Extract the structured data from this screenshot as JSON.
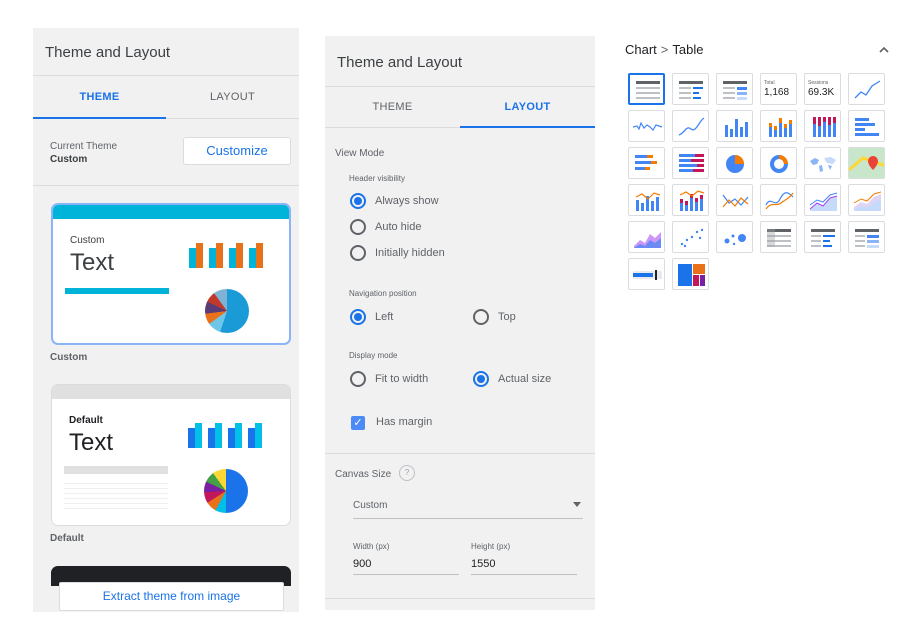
{
  "theme_panel": {
    "title": "Theme and Layout",
    "tabs": [
      "THEME",
      "LAYOUT"
    ],
    "current_theme_label": "Current Theme",
    "current_theme_value": "Custom",
    "customize_label": "Customize",
    "cards": [
      {
        "name": "Custom",
        "text": "Text",
        "caption": "Custom"
      },
      {
        "name": "Default",
        "text": "Text",
        "caption": "Default"
      }
    ],
    "extract_label": "Extract theme from image"
  },
  "layout_panel": {
    "title": "Theme and Layout",
    "tabs": [
      "THEME",
      "LAYOUT"
    ],
    "view_mode_label": "View Mode",
    "header_visibility_label": "Header visibility",
    "header_options": [
      "Always show",
      "Auto hide",
      "Initially hidden"
    ],
    "header_selected": "Always show",
    "nav_position_label": "Navigation position",
    "nav_options": [
      "Left",
      "Top"
    ],
    "nav_selected": "Left",
    "display_mode_label": "Display mode",
    "display_options": [
      "Fit to width",
      "Actual size"
    ],
    "display_selected": "Actual size",
    "has_margin_label": "Has margin",
    "has_margin_checked": true,
    "canvas_size_label": "Canvas Size",
    "help_icon_text": "?",
    "canvas_size_value": "Custom",
    "width_label": "Width (px)",
    "width_value": "900",
    "height_label": "Height (px)",
    "height_value": "1550"
  },
  "chart_picker": {
    "breadcrumb_parent": "Chart",
    "breadcrumb_sep": ">",
    "breadcrumb_current": "Table",
    "kpi_total_label": "Total",
    "kpi_total_value": "1,168",
    "kpi_sessions_label": "Sessions",
    "kpi_sessions_value": "69.3K",
    "items": [
      "table",
      "table-bars",
      "table-heatmap",
      "scorecard",
      "scorecard-compact",
      "time-series",
      "sparkline",
      "smoothed-time-series",
      "column",
      "stacked-column",
      "100-stacked-column",
      "bar",
      "stacked-bar",
      "100-stacked-bar",
      "pie",
      "donut",
      "geo-map",
      "google-map",
      "combo",
      "stacked-combo",
      "line",
      "smoothed-line",
      "area",
      "stacked-area",
      "100-stacked-area",
      "scatter",
      "bubble",
      "pivot-table",
      "pivot-table-bars",
      "pivot-table-heatmap",
      "bullet",
      "treemap"
    ],
    "selected": "table"
  },
  "colors": {
    "accent": "#1a73e8",
    "panel_bg": "#f1f1f1",
    "custom_band": "#00b3d8",
    "default_band": "#e0e0e0"
  }
}
